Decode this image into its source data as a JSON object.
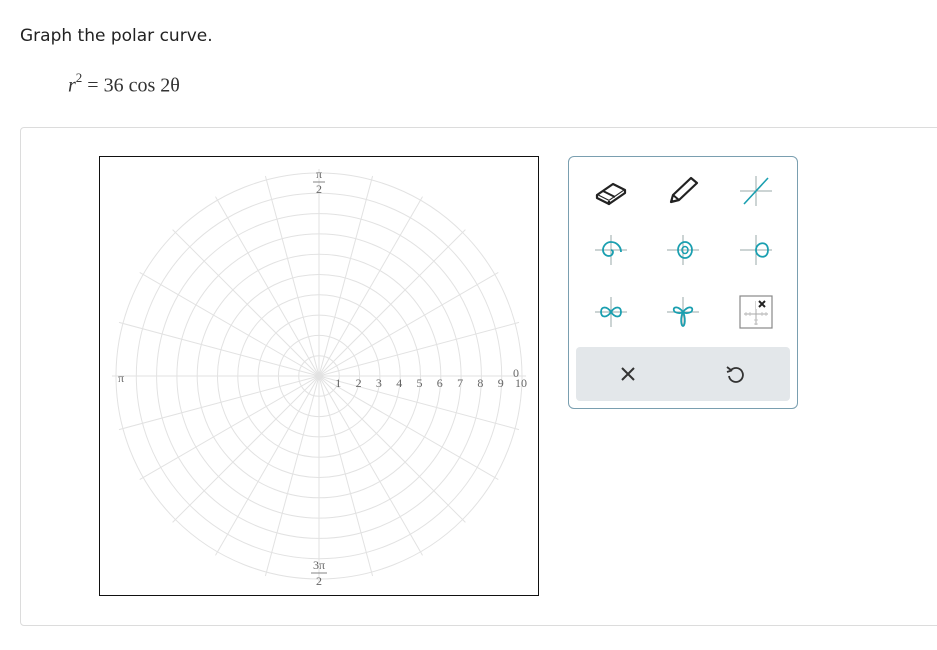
{
  "question": {
    "prompt": "Graph the polar curve.",
    "equation_lhs_var": "r",
    "equation_lhs_exp": "2",
    "equation_rhs": "= 36 cos 2θ"
  },
  "graph": {
    "r_tick_labels": [
      "1",
      "2",
      "3",
      "4",
      "5",
      "6",
      "7",
      "8",
      "9",
      "10"
    ],
    "angle_top_num": "π",
    "angle_top_den": "2",
    "angle_left": "π",
    "angle_right": "0",
    "angle_bottom_num": "3π",
    "angle_bottom_den": "2",
    "grid_color": "#e2e2e2"
  },
  "toolbox": {
    "tools": [
      {
        "name": "eraser-tool",
        "icon": "eraser-icon"
      },
      {
        "name": "pencil-tool",
        "icon": "pencil-icon"
      },
      {
        "name": "line-tool",
        "icon": "line-icon"
      },
      {
        "name": "spiral-tool",
        "icon": "spiral-icon"
      },
      {
        "name": "limacon-tool",
        "icon": "limacon-icon"
      },
      {
        "name": "cardioid-tool",
        "icon": "cardioid-icon"
      },
      {
        "name": "lemniscate-tool",
        "icon": "lemniscate-icon"
      },
      {
        "name": "rose-tool",
        "icon": "rose-icon"
      },
      {
        "name": "no-solution-tool",
        "icon": "no-solution-icon"
      }
    ],
    "actions": [
      {
        "name": "clear-button",
        "icon": "x-icon"
      },
      {
        "name": "undo-button",
        "icon": "undo-icon"
      }
    ],
    "accent_color": "#1a9fb0",
    "border_color": "#7a9fb0"
  }
}
